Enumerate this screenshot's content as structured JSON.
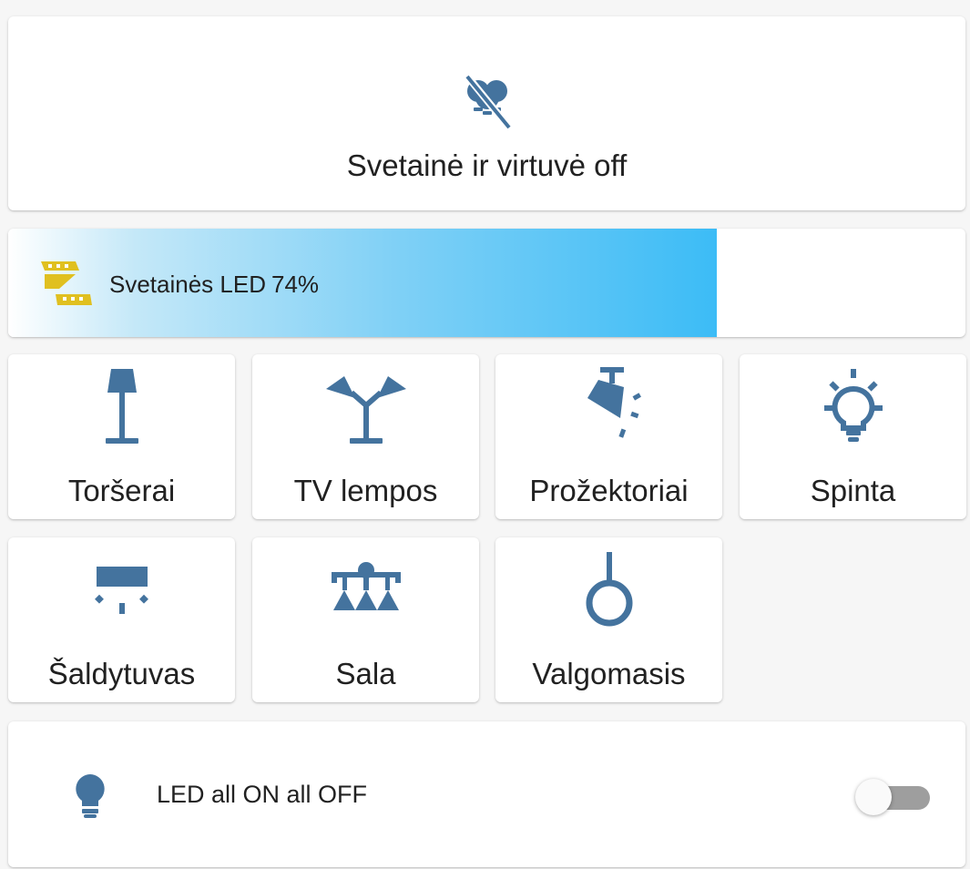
{
  "scene": {
    "label": "Svetainė ir virtuvė off",
    "icon": "lightbulb-group-off-icon"
  },
  "dimmer": {
    "name": "Svetainės LED",
    "brightness_text": "74%",
    "brightness": 74,
    "icon": "led-strip-icon",
    "icon_color": "#e0c020"
  },
  "tiles": [
    {
      "label": "Toršerai",
      "icon": "floor-lamp-icon"
    },
    {
      "label": "TV lempos",
      "icon": "wall-lamps-icon"
    },
    {
      "label": "Prožektoriai",
      "icon": "spotlight-icon"
    },
    {
      "label": "Spinta",
      "icon": "lightbulb-on-outline-icon"
    },
    {
      "label": "Šaldytuvas",
      "icon": "ceiling-light-icon"
    },
    {
      "label": "Sala",
      "icon": "chandelier-icon"
    },
    {
      "label": "Valgomasis",
      "icon": "ceiling-pendant-icon"
    }
  ],
  "toggle_row": {
    "label": "LED all ON all OFF",
    "icon": "lightbulb-icon",
    "state": "off"
  },
  "colors": {
    "icon": "#44739e",
    "accent": "#3cbcf6",
    "card": "#ffffff",
    "background": "#f6f6f6"
  }
}
